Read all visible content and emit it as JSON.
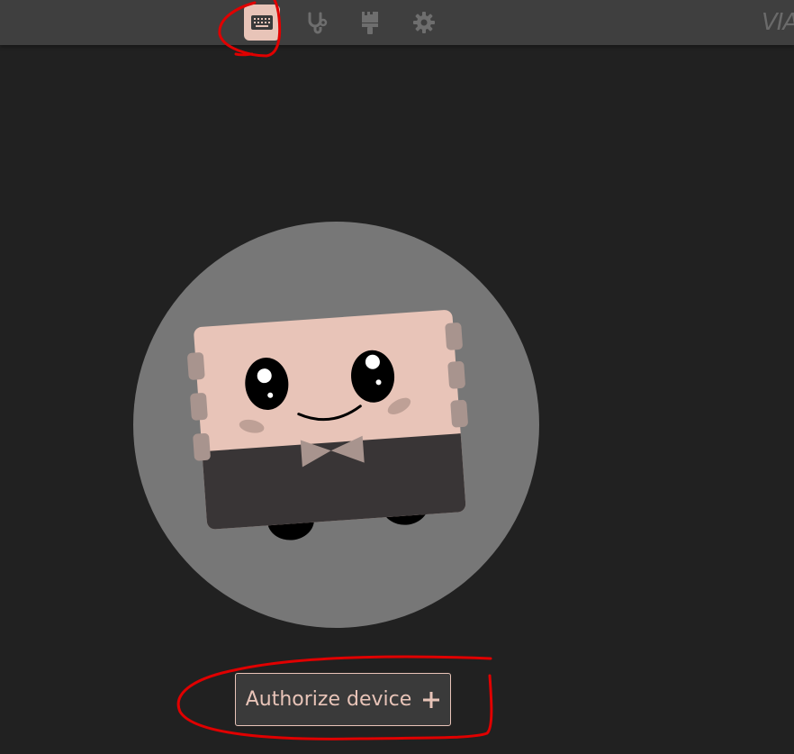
{
  "navbar": {
    "items": [
      {
        "icon": "keyboard-icon",
        "active": true
      },
      {
        "icon": "stethoscope-icon",
        "active": false
      },
      {
        "icon": "paintbrush-icon",
        "active": false
      },
      {
        "icon": "gear-icon",
        "active": false
      }
    ],
    "logo_text": "VIA"
  },
  "hero": {
    "illustration": "keyboard-mascot-illustration"
  },
  "authorize": {
    "label": "Authorize device",
    "icon": "plus-icon"
  },
  "colors": {
    "background": "#212121",
    "topbar": "#3f3f3f",
    "accent": "#e8c4b8",
    "circle": "#777777",
    "annotation": "#e00000"
  }
}
